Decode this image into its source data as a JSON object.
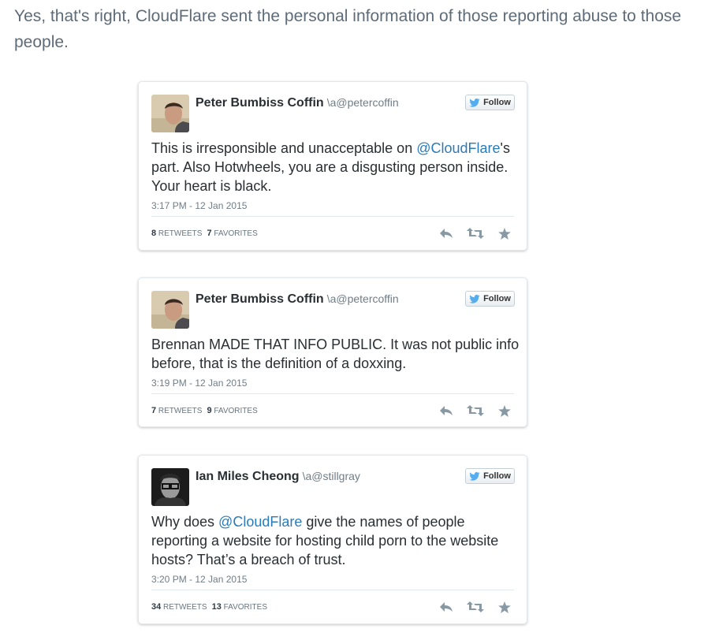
{
  "intro": "Yes, that's right, CloudFlare sent the personal information of those reporting abuse to those people.",
  "follow_label": "Follow",
  "tweets": [
    {
      "name": "Peter Bumbiss Coffin",
      "handle": "\\a@petercoffin",
      "avatar": "person-profile-photo",
      "text": [
        {
          "t": "This is irresponsible and unacceptable on "
        },
        {
          "t": "@CloudFlare",
          "mention": true
        },
        {
          "t": "'s part. Also Hotwheels, you are a disgusting person inside. Your heart is black."
        }
      ],
      "time": "3:17 PM - 12 Jan 2015",
      "retweets": "8",
      "retweets_label": "RETWEETS",
      "favorites": "7",
      "favorites_label": "FAVORITES"
    },
    {
      "name": "Peter Bumbiss Coffin",
      "handle": "\\a@petercoffin",
      "avatar": "person-profile-photo",
      "text": [
        {
          "t": "Brennan MADE THAT INFO PUBLIC. It was not public info before, that is the definition of a doxxing."
        }
      ],
      "time": "3:19 PM - 12 Jan 2015",
      "retweets": "7",
      "retweets_label": "RETWEETS",
      "favorites": "9",
      "favorites_label": "FAVORITES"
    },
    {
      "name": "Ian Miles Cheong",
      "handle": "\\a@stillgray",
      "avatar": "person-bw-photo",
      "text": [
        {
          "t": "Why does "
        },
        {
          "t": "@CloudFlare",
          "mention": true
        },
        {
          "t": " give the names of people reporting a website for hosting child porn to the website hosts? That’s a breach of trust."
        }
      ],
      "time": "3:20 PM - 12 Jan 2015",
      "retweets": "34",
      "retweets_label": "RETWEETS",
      "favorites": "13",
      "favorites_label": "FAVORITES"
    }
  ]
}
